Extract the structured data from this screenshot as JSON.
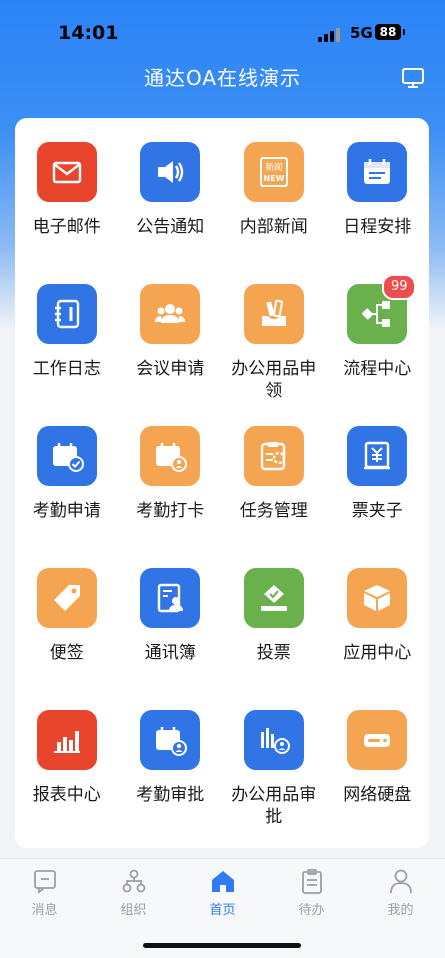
{
  "status_bar": {
    "time": "14:01",
    "network": "5G",
    "battery": "88"
  },
  "header": {
    "title": "通达OA在线演示"
  },
  "apps": [
    {
      "label": "电子邮件",
      "icon": "mail-icon",
      "color": "#e8452c"
    },
    {
      "label": "公告通知",
      "icon": "speaker-icon",
      "color": "#3174e6"
    },
    {
      "label": "内部新闻",
      "icon": "news-icon",
      "color": "#f5a451",
      "icon_text_1": "新闻",
      "icon_text_2": "NEW"
    },
    {
      "label": "日程安排",
      "icon": "calendar-icon",
      "color": "#3174e6"
    },
    {
      "label": "工作日志",
      "icon": "notebook-icon",
      "color": "#3174e6"
    },
    {
      "label": "会议申请",
      "icon": "group-icon",
      "color": "#f5a451"
    },
    {
      "label": "办公用品申领",
      "icon": "supplies-icon",
      "color": "#f5a451"
    },
    {
      "label": "流程中心",
      "icon": "flow-icon",
      "color": "#6ab04c",
      "badge": "99"
    },
    {
      "label": "考勤申请",
      "icon": "calendar-check-icon",
      "color": "#3174e6"
    },
    {
      "label": "考勤打卡",
      "icon": "calendar-user-icon",
      "color": "#f5a451"
    },
    {
      "label": "任务管理",
      "icon": "task-icon",
      "color": "#f5a451"
    },
    {
      "label": "票夹子",
      "icon": "ticket-icon",
      "color": "#3174e6"
    },
    {
      "label": "便签",
      "icon": "tag-icon",
      "color": "#f5a451"
    },
    {
      "label": "通讯簿",
      "icon": "contacts-icon",
      "color": "#3174e6"
    },
    {
      "label": "投票",
      "icon": "vote-icon",
      "color": "#6ab04c"
    },
    {
      "label": "应用中心",
      "icon": "box-icon",
      "color": "#f5a451"
    },
    {
      "label": "报表中心",
      "icon": "bar-chart-icon",
      "color": "#e8452c"
    },
    {
      "label": "考勤审批",
      "icon": "calendar-user-icon",
      "color": "#3174e6"
    },
    {
      "label": "办公用品审批",
      "icon": "supplies-approve-icon",
      "color": "#3174e6"
    },
    {
      "label": "网络硬盘",
      "icon": "drive-icon",
      "color": "#f5a451"
    }
  ],
  "tabbar": [
    {
      "label": "消息",
      "icon": "message-icon",
      "active": false
    },
    {
      "label": "组织",
      "icon": "org-icon",
      "active": false
    },
    {
      "label": "首页",
      "icon": "home-icon",
      "active": true
    },
    {
      "label": "待办",
      "icon": "clipboard-icon",
      "active": false
    },
    {
      "label": "我的",
      "icon": "profile-icon",
      "active": false
    }
  ]
}
